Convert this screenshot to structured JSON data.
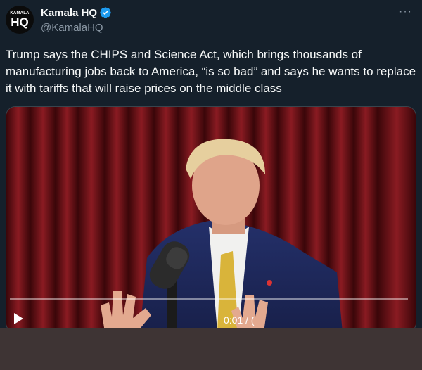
{
  "account": {
    "display_name": "Kamala HQ",
    "handle": "@KamalaHQ",
    "avatar_small": "KAMALA",
    "avatar_big": "HQ",
    "verified_icon": "verified-badge-icon",
    "verified_color": "#1d9bf0"
  },
  "menu": {
    "more_label": "···"
  },
  "tweet": {
    "text": "Trump says the CHIPS and Science Act, which brings thousands of manufacturing jobs back to America, “is so bad” and says he wants to replace it with tariffs that will raise prices on the middle class"
  },
  "video": {
    "time_label": "0:01 / (",
    "progress_fraction": 0.0,
    "play_icon": "play-icon"
  },
  "colors": {
    "background": "#15202b",
    "text": "#f7f9f9",
    "muted": "#8b98a5",
    "curtain": "#6a1016"
  }
}
